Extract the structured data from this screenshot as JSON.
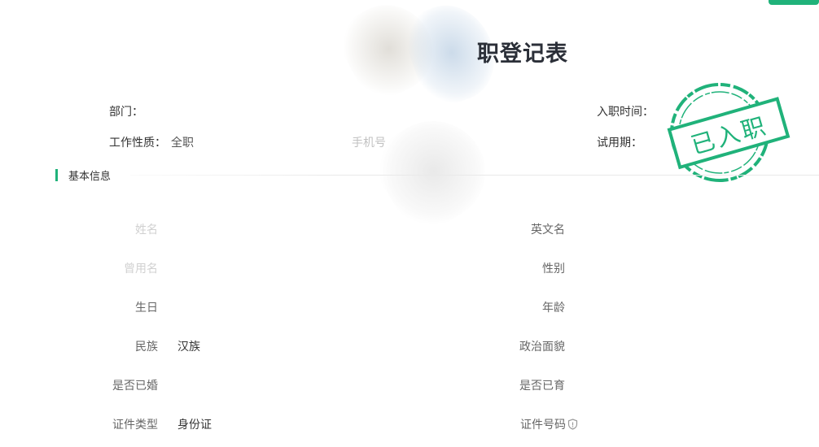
{
  "page": {
    "title": "职登记表"
  },
  "meta": {
    "department_label": "部门：",
    "department_value": "",
    "hire_date_label": "入职时间：",
    "hire_date_value": "",
    "job_type_label": "工作性质：",
    "job_type_value": "全职",
    "phone_label": "手机号",
    "probation_label": "试用期："
  },
  "stamp": {
    "text": "已入职",
    "color": "#20b27a"
  },
  "section": {
    "title": "基本信息"
  },
  "fields": {
    "name_label": "姓名",
    "name_value": "",
    "english_name_label": "英文名",
    "former_name_label": "曾用名",
    "gender_label": "性别",
    "birthday_label": "生日",
    "age_label": "年龄",
    "ethnicity_label": "民族",
    "ethnicity_value": "汉族",
    "political_status_label": "政治面貌",
    "married_label": "是否已婚",
    "has_children_label": "是否已育",
    "id_type_label": "证件类型",
    "id_type_value": "身份证",
    "id_number_label": "证件号码"
  },
  "icons": {
    "id_number_icon": "shield-icon"
  },
  "colors": {
    "accent": "#20b27a",
    "title": "#2b2f38",
    "label": "#666666",
    "value": "#333333"
  }
}
